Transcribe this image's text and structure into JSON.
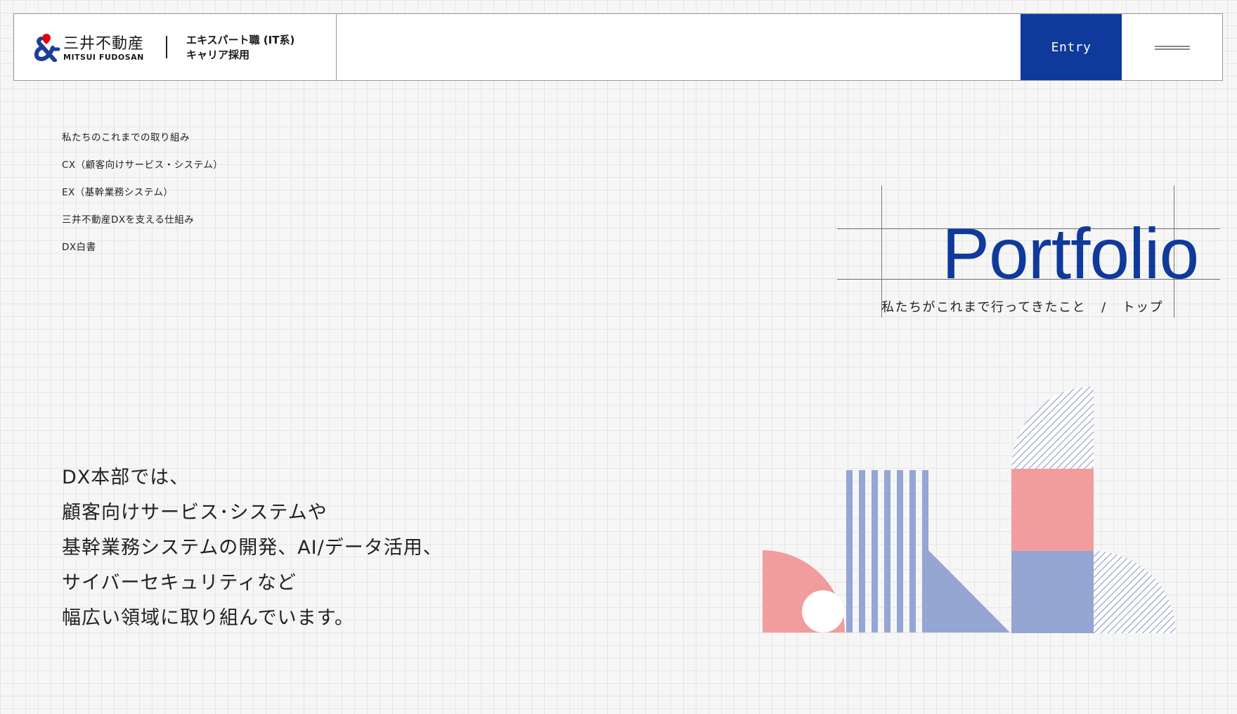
{
  "header": {
    "logo_jp": "三井不動産",
    "logo_en": "MITSUI FUDOSAN",
    "title_line1": "エキスパート職 (IT系)",
    "title_line2": "キャリア採用",
    "entry_label": "Entry"
  },
  "side_nav": {
    "items": [
      {
        "label": "私たちのこれまでの取り組み"
      },
      {
        "label": "CX（顧客向けサービス・システム）"
      },
      {
        "label": "EX（基幹業務システム）"
      },
      {
        "label": "三井不動産DXを支える仕組み"
      },
      {
        "label": "DX白書"
      }
    ]
  },
  "portfolio": {
    "title": "Portfolio",
    "subtitle": "私たちがこれまで行ってきたこと",
    "separator": "/",
    "breadcrumb": "トップ"
  },
  "lead": {
    "lines": [
      "DX本部では、",
      "顧客向けサービス･システムや",
      "基幹業務システムの開発、AI/データ活用、",
      "サイバーセキュリティなど",
      "幅広い領域に取り組んでいます。"
    ]
  },
  "colors": {
    "brand_blue": "#0f3a9b",
    "brand_red": "#e60012",
    "illustration_blue": "#94a6d1",
    "illustration_pink": "#f19c9d"
  }
}
